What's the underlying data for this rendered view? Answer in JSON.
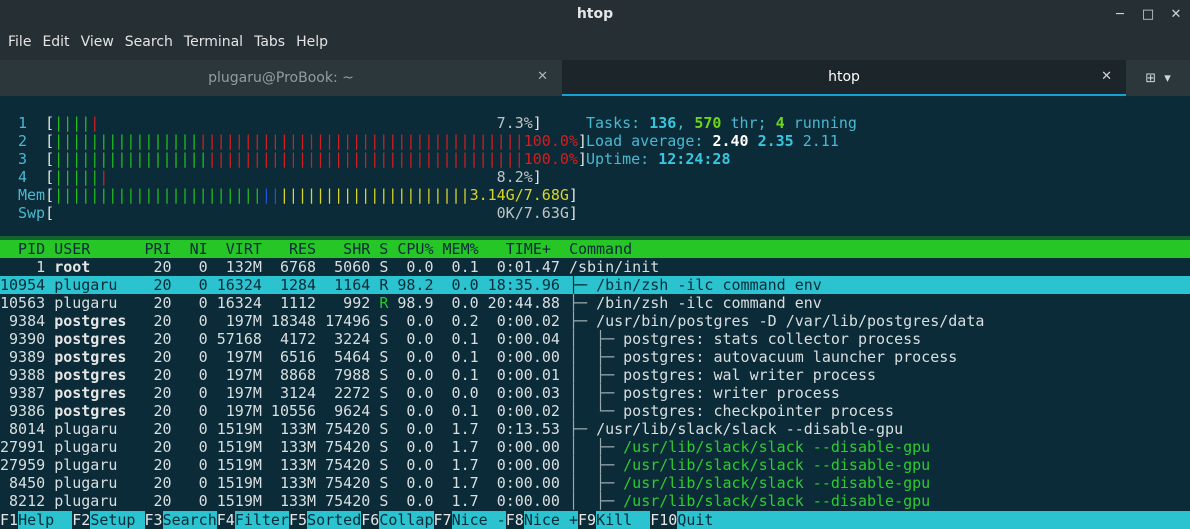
{
  "window": {
    "title": "htop",
    "minimize": "─",
    "maximize": "□",
    "close": "✕"
  },
  "menu": [
    "File",
    "Edit",
    "View",
    "Search",
    "Terminal",
    "Tabs",
    "Help"
  ],
  "tabs": [
    {
      "label": "plugaru@ProBook: ~",
      "active": false
    },
    {
      "label": "htop",
      "active": true
    }
  ],
  "meters": {
    "cpu": [
      {
        "id": "1",
        "green": "||||",
        "red": "|",
        "pad": "                                                    ",
        "value": "7.3%"
      },
      {
        "id": "2",
        "green": "||||||||||||||||",
        "red": "||||||||||||||||||||||||||||||||||||",
        "pad": "",
        "value": "100.0%"
      },
      {
        "id": "3",
        "green": "|||||||||||||||||",
        "red": "|||||||||||||||||||||||||||||||||||",
        "pad": "",
        "value": "100.0%"
      },
      {
        "id": "4",
        "green": "|||||",
        "red": "|",
        "pad": "                                                   ",
        "value": "8.2%"
      }
    ],
    "mem": {
      "label": "Mem",
      "green": "|||||||||||||||||||||||",
      "blue": "||",
      "yellow": "|||||||||||||||||||||",
      "value": "3.14G/7.68G"
    },
    "swp": {
      "label": "Swp",
      "value": "0K/7.63G"
    }
  },
  "stats": {
    "tasks_label": "Tasks: ",
    "tasks": "136",
    "thr": "570",
    "thr_label": " thr; ",
    "running": "4",
    "running_label": " running",
    "load_label": "Load average: ",
    "load1": "2.40",
    "load5": "2.35",
    "load15": "2.11",
    "uptime_label": "Uptime: ",
    "uptime": "12:24:28"
  },
  "header": "  PID USER      PRI  NI  VIRT   RES   SHR S CPU% MEM%   TIME+  Command",
  "processes": [
    {
      "pid": "1",
      "user": "root",
      "bold": true,
      "pri": "20",
      "ni": "0",
      "virt": "132M",
      "res": "6768",
      "shr": "5060",
      "s": "S",
      "cpu": "0.0",
      "mem": "0.1",
      "time": "0:01.47",
      "tree": "",
      "cmd": "/sbin/init",
      "green": false
    },
    {
      "pid": "10954",
      "user": "plugaru",
      "bold": false,
      "pri": "20",
      "ni": "0",
      "virt": "16324",
      "res": "1284",
      "shr": "1164",
      "s": "R",
      "cpu": "98.2",
      "mem": "0.0",
      "time": "18:35.96",
      "tree": "├─ ",
      "cmd": "/bin/zsh -ilc command env",
      "green": false
    },
    {
      "pid": "10563",
      "user": "plugaru",
      "bold": false,
      "pri": "20",
      "ni": "0",
      "virt": "16324",
      "res": "1112",
      "shr": "992",
      "s": "R",
      "cpu": "98.9",
      "mem": "0.0",
      "time": "20:44.88",
      "tree": "├─ ",
      "cmd": "/bin/zsh -ilc command env",
      "green": false
    },
    {
      "pid": "9384",
      "user": "postgres",
      "bold": true,
      "pri": "20",
      "ni": "0",
      "virt": "197M",
      "res": "18348",
      "shr": "17496",
      "s": "S",
      "cpu": "0.0",
      "mem": "0.2",
      "time": "0:00.02",
      "tree": "├─ ",
      "cmd": "/usr/bin/postgres -D /var/lib/postgres/data",
      "green": false
    },
    {
      "pid": "9390",
      "user": "postgres",
      "bold": true,
      "pri": "20",
      "ni": "0",
      "virt": "57168",
      "res": "4172",
      "shr": "3224",
      "s": "S",
      "cpu": "0.0",
      "mem": "0.1",
      "time": "0:00.04",
      "tree": "│  ├─ ",
      "cmd": "postgres: stats collector process",
      "green": false
    },
    {
      "pid": "9389",
      "user": "postgres",
      "bold": true,
      "pri": "20",
      "ni": "0",
      "virt": "197M",
      "res": "6516",
      "shr": "5464",
      "s": "S",
      "cpu": "0.0",
      "mem": "0.1",
      "time": "0:00.00",
      "tree": "│  ├─ ",
      "cmd": "postgres: autovacuum launcher process",
      "green": false
    },
    {
      "pid": "9388",
      "user": "postgres",
      "bold": true,
      "pri": "20",
      "ni": "0",
      "virt": "197M",
      "res": "8868",
      "shr": "7988",
      "s": "S",
      "cpu": "0.0",
      "mem": "0.1",
      "time": "0:00.01",
      "tree": "│  ├─ ",
      "cmd": "postgres: wal writer process",
      "green": false
    },
    {
      "pid": "9387",
      "user": "postgres",
      "bold": true,
      "pri": "20",
      "ni": "0",
      "virt": "197M",
      "res": "3124",
      "shr": "2272",
      "s": "S",
      "cpu": "0.0",
      "mem": "0.0",
      "time": "0:00.03",
      "tree": "│  ├─ ",
      "cmd": "postgres: writer process",
      "green": false
    },
    {
      "pid": "9386",
      "user": "postgres",
      "bold": true,
      "pri": "20",
      "ni": "0",
      "virt": "197M",
      "res": "10556",
      "shr": "9624",
      "s": "S",
      "cpu": "0.0",
      "mem": "0.1",
      "time": "0:00.02",
      "tree": "│  └─ ",
      "cmd": "postgres: checkpointer process",
      "green": false
    },
    {
      "pid": "8014",
      "user": "plugaru",
      "bold": false,
      "pri": "20",
      "ni": "0",
      "virt": "1519M",
      "res": "133M",
      "shr": "75420",
      "s": "S",
      "cpu": "0.0",
      "mem": "1.7",
      "time": "0:13.53",
      "tree": "├─ ",
      "cmd": "/usr/lib/slack/slack --disable-gpu",
      "green": false
    },
    {
      "pid": "27991",
      "user": "plugaru",
      "bold": false,
      "pri": "20",
      "ni": "0",
      "virt": "1519M",
      "res": "133M",
      "shr": "75420",
      "s": "S",
      "cpu": "0.0",
      "mem": "1.7",
      "time": "0:00.00",
      "tree": "│  ├─ ",
      "cmd": "/usr/lib/slack/slack --disable-gpu",
      "green": true
    },
    {
      "pid": "27959",
      "user": "plugaru",
      "bold": false,
      "pri": "20",
      "ni": "0",
      "virt": "1519M",
      "res": "133M",
      "shr": "75420",
      "s": "S",
      "cpu": "0.0",
      "mem": "1.7",
      "time": "0:00.00",
      "tree": "│  ├─ ",
      "cmd": "/usr/lib/slack/slack --disable-gpu",
      "green": true
    },
    {
      "pid": "8450",
      "user": "plugaru",
      "bold": false,
      "pri": "20",
      "ni": "0",
      "virt": "1519M",
      "res": "133M",
      "shr": "75420",
      "s": "S",
      "cpu": "0.0",
      "mem": "1.7",
      "time": "0:00.00",
      "tree": "│  ├─ ",
      "cmd": "/usr/lib/slack/slack --disable-gpu",
      "green": true
    },
    {
      "pid": "8212",
      "user": "plugaru",
      "bold": false,
      "pri": "20",
      "ni": "0",
      "virt": "1519M",
      "res": "133M",
      "shr": "75420",
      "s": "S",
      "cpu": "0.0",
      "mem": "1.7",
      "time": "0:00.00",
      "tree": "│  ├─ ",
      "cmd": "/usr/lib/slack/slack --disable-gpu",
      "green": true
    }
  ],
  "selected_index": 1,
  "footer": [
    {
      "key": "F1",
      "label": "Help  "
    },
    {
      "key": "F2",
      "label": "Setup "
    },
    {
      "key": "F3",
      "label": "Search"
    },
    {
      "key": "F4",
      "label": "Filter"
    },
    {
      "key": "F5",
      "label": "Sorted"
    },
    {
      "key": "F6",
      "label": "Collap"
    },
    {
      "key": "F7",
      "label": "Nice -"
    },
    {
      "key": "F8",
      "label": "Nice +"
    },
    {
      "key": "F9",
      "label": "Kill  "
    },
    {
      "key": "F10",
      "label": "Quit  "
    }
  ]
}
